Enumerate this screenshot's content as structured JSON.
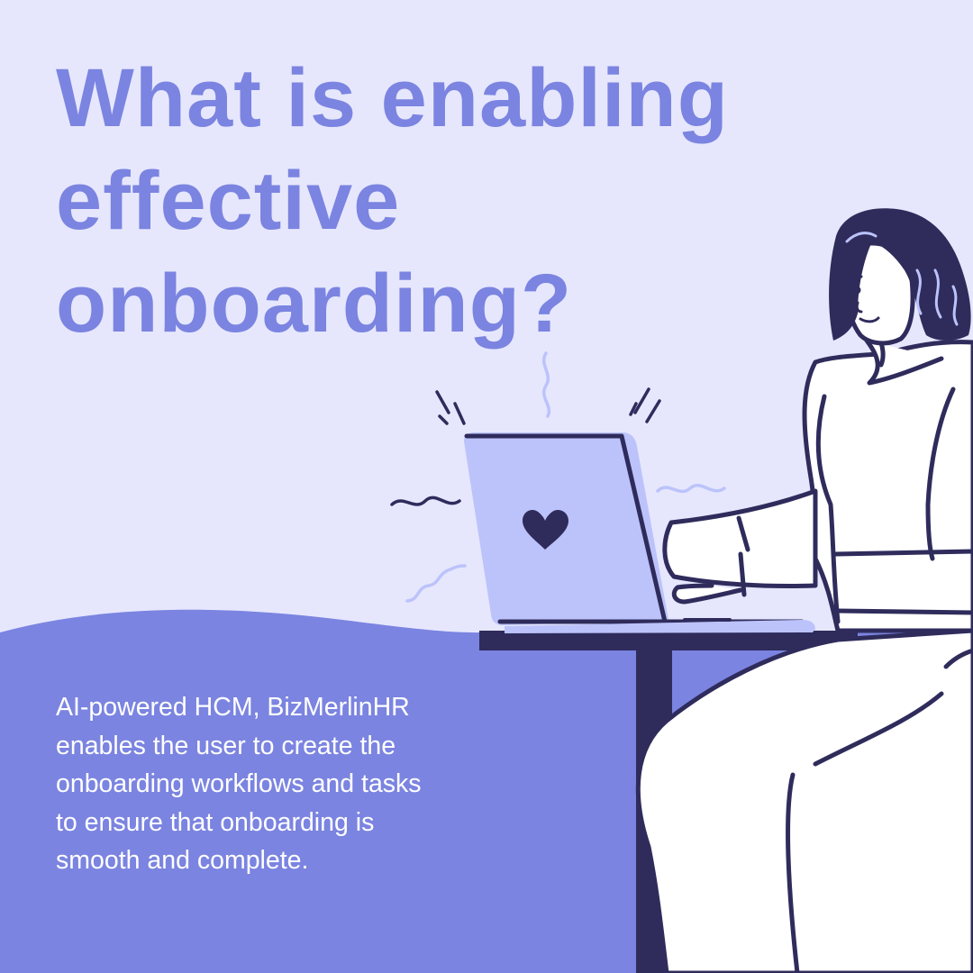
{
  "headline": {
    "lines": [
      "What is enabling",
      "effective",
      "onboarding?"
    ]
  },
  "body": {
    "lines": [
      "AI-powered HCM, BizMerlinHR",
      "enables the user to create the",
      "onboarding workflows and tasks",
      "to ensure that onboarding is",
      "smooth and complete."
    ]
  },
  "colors": {
    "background": "#e6e7fd",
    "accent": "#7b84e0",
    "dark": "#2f2c5c",
    "laptop": "#bcc3fb",
    "white": "#ffffff"
  },
  "illustration": {
    "subject": "woman-using-laptop",
    "laptop_icon": "heart-icon"
  }
}
